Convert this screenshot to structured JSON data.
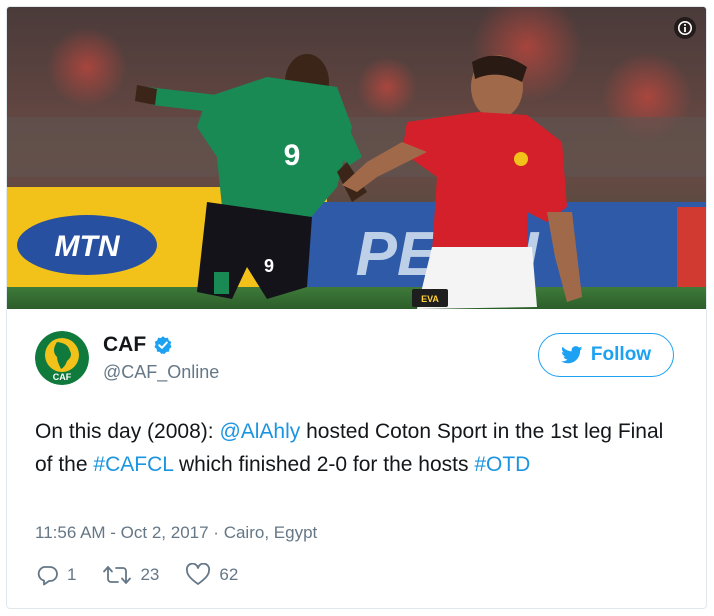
{
  "tweet": {
    "author": {
      "display_name": "CAF",
      "handle": "@CAF_Online",
      "verified": true,
      "avatar_text": "CAF"
    },
    "follow_label": "Follow",
    "text_segments": [
      {
        "text": "On this day (2008): ",
        "type": "text"
      },
      {
        "text": "@AlAhly",
        "type": "mention"
      },
      {
        "text": " hosted Coton Sport in the 1st leg Final of the ",
        "type": "text"
      },
      {
        "text": "#CAFCL",
        "type": "hashtag"
      },
      {
        "text": " which finished 2-0 for the hosts ",
        "type": "text"
      },
      {
        "text": "#OTD",
        "type": "hashtag"
      }
    ],
    "timestamp": "11:56 AM - Oct 2, 2017",
    "separator": "·",
    "location": "Cairo, Egypt",
    "stats": {
      "replies": "1",
      "retweets": "23",
      "likes": "62"
    },
    "media": {
      "jersey_number_left": "9",
      "shorts_number_left": "9",
      "sponsor_left": "MTN",
      "sponsor_right": "PEPSI",
      "badge": "EVA"
    }
  },
  "colors": {
    "brand_blue": "#1da1f2",
    "link_blue": "#1b95e0",
    "text_primary": "#14171a",
    "text_secondary": "#657786",
    "border": "#e1e8ed"
  }
}
